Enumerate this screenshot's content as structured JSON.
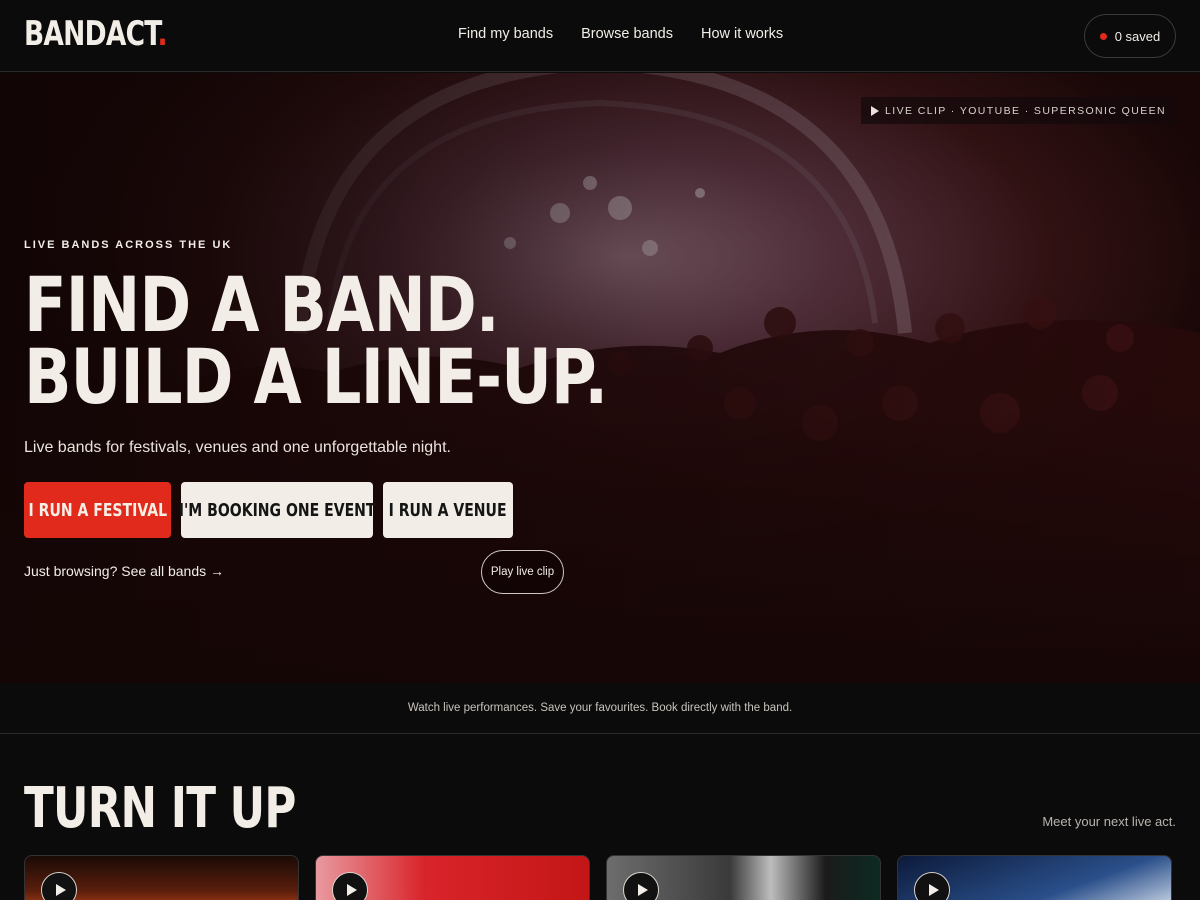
{
  "header": {
    "logo_text": "BANDACT",
    "logo_dot": ".",
    "nav": [
      "Find my bands",
      "Browse bands",
      "How it works"
    ],
    "saved_label": "0 saved"
  },
  "hero": {
    "clip_badge": "LIVE CLIP · YOUTUBE · SUPERSONIC QUEEN",
    "eyebrow": "LIVE BANDS ACROSS THE UK",
    "headline_line1": "FIND A BAND.",
    "headline_line2": "BUILD A LINE-UP.",
    "subtitle": "Live bands for festivals, venues and one unforgettable night.",
    "buttons": [
      "I RUN A FESTIVAL",
      "I'M BOOKING ONE EVENT",
      "I RUN A VENUE"
    ],
    "browse_link": "Just browsing? See all bands →",
    "play_clip": "Play live clip"
  },
  "strip_text": "Watch live performances. Save your favourites. Book directly with the band.",
  "section": {
    "title": "TURN IT UP",
    "subtitle": "Meet your next live act."
  },
  "colors": {
    "accent": "#e12a1c",
    "cream": "#f2ede6",
    "background": "#0b0b0b"
  }
}
